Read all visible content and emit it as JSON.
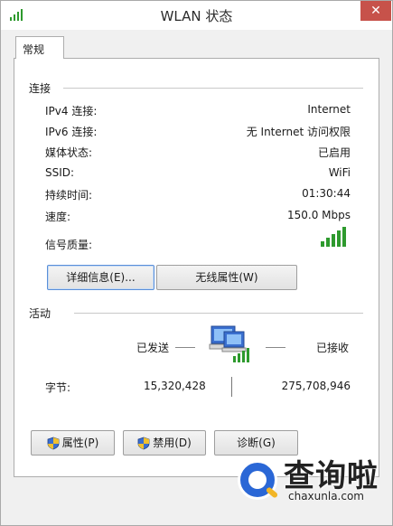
{
  "window": {
    "title": "WLAN 状态",
    "close_glyph": "✕",
    "icon": "signal-bars-icon"
  },
  "tabs": [
    {
      "label": "常规",
      "selected": true
    }
  ],
  "connection": {
    "section_title": "连接",
    "rows": [
      {
        "label": "IPv4 连接:",
        "value": "Internet"
      },
      {
        "label": "IPv6 连接:",
        "value": "无 Internet 访问权限"
      },
      {
        "label": "媒体状态:",
        "value": "已启用"
      },
      {
        "label": "SSID:",
        "value": "WiFi"
      },
      {
        "label": "持续时间:",
        "value": "01:30:44"
      },
      {
        "label": "速度:",
        "value": "150.0 Mbps"
      }
    ],
    "signal_label": "信号质量:",
    "signal_bars_filled": 5,
    "signal_bars_total": 5,
    "details_button": "详细信息(E)...",
    "wireless_props_button": "无线属性(W)"
  },
  "activity": {
    "section_title": "活动",
    "sent_label": "已发送",
    "received_label": "已接收",
    "bytes_label": "字节:",
    "bytes_sent": "15,320,428",
    "bytes_received": "275,708,946"
  },
  "bottom_buttons": {
    "properties": "属性(P)",
    "disable": "禁用(D)",
    "diagnose": "诊断(G)"
  },
  "watermark": {
    "big_text": "查询啦",
    "small_text": "chaxunla.com"
  },
  "colors": {
    "signal_green": "#2e9a2e",
    "close_red": "#c7524a",
    "focus_blue": "#5a8fd8"
  }
}
